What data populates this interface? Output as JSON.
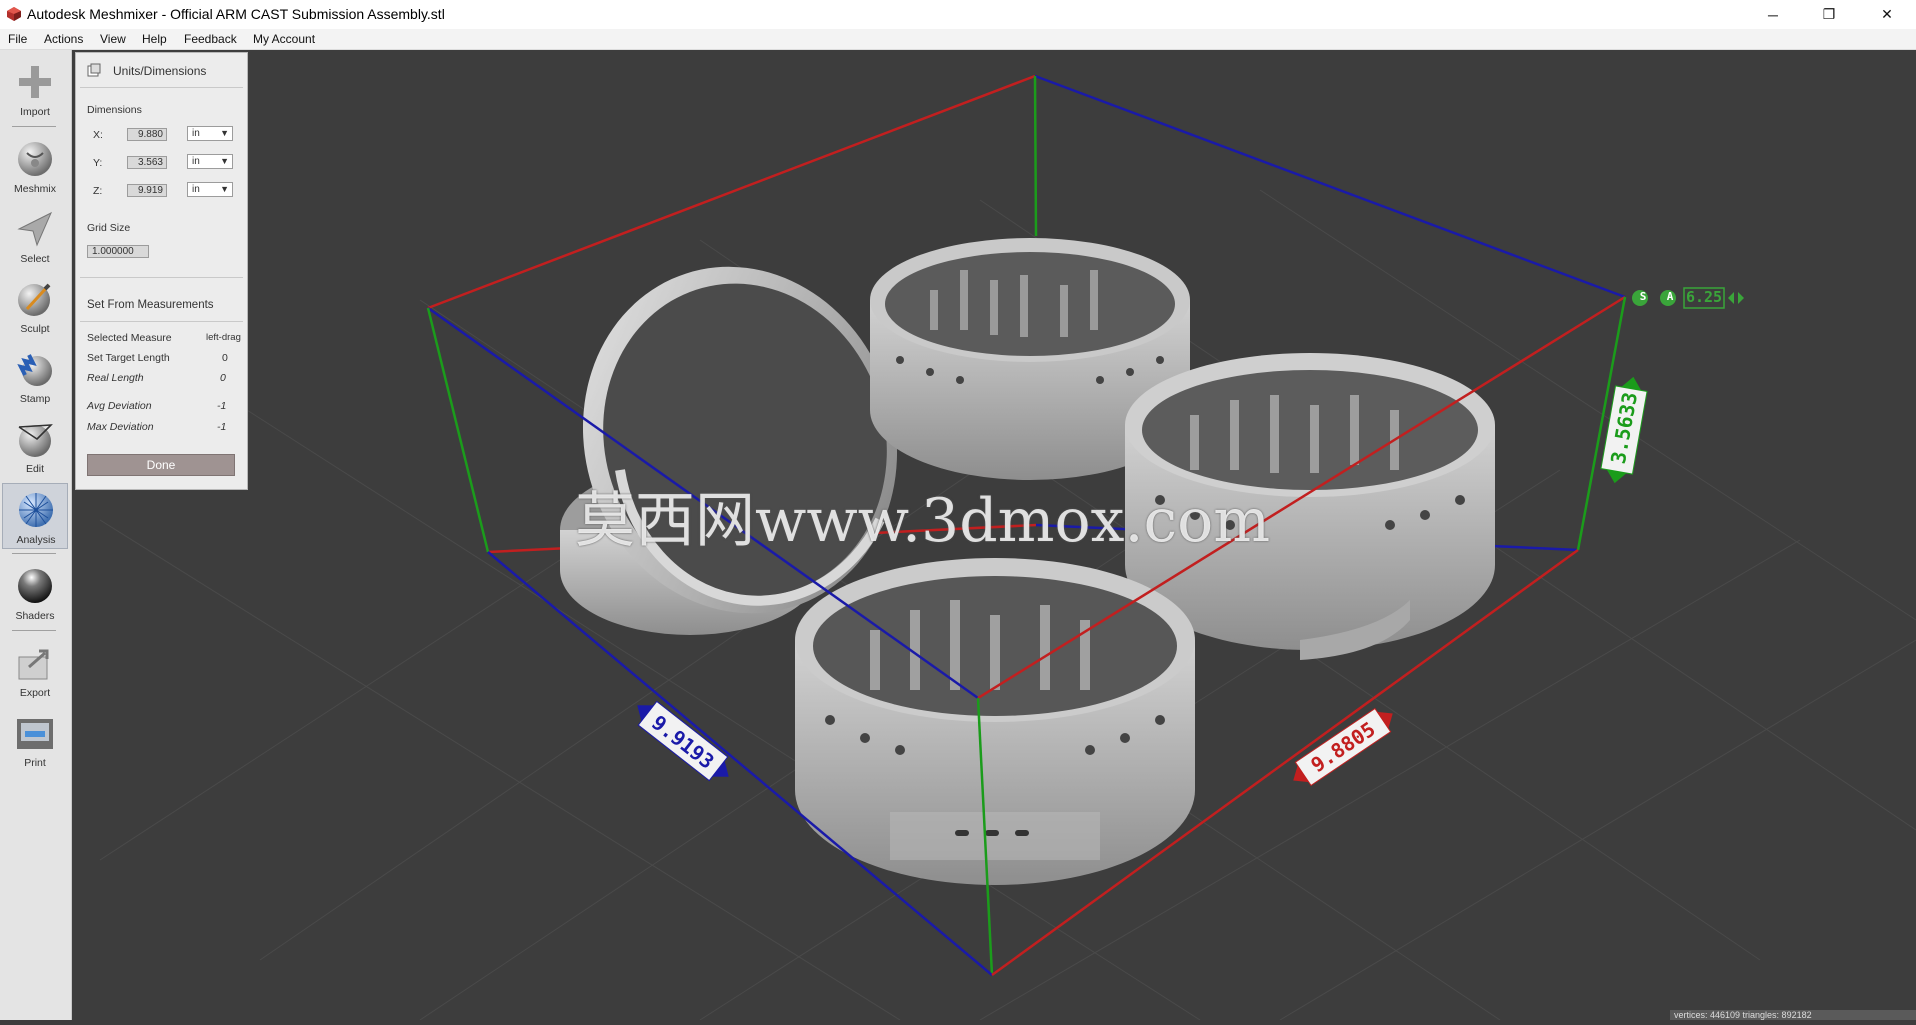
{
  "window": {
    "title": "Autodesk Meshmixer - Official ARM CAST Submission Assembly.stl",
    "minimize": "─",
    "restore": "❐",
    "close": "✕"
  },
  "menu": [
    "File",
    "Actions",
    "View",
    "Help",
    "Feedback",
    "My Account"
  ],
  "toolbar": {
    "items": [
      {
        "label": "Import",
        "icon": "plus-icon"
      },
      {
        "label": "Meshmix",
        "icon": "meshmix-icon"
      },
      {
        "label": "Select",
        "icon": "arrow-cursor-icon"
      },
      {
        "label": "Sculpt",
        "icon": "sculpt-brush-icon"
      },
      {
        "label": "Stamp",
        "icon": "stamp-icon"
      },
      {
        "label": "Edit",
        "icon": "edit-icon"
      },
      {
        "label": "Analysis",
        "icon": "analysis-icon"
      },
      {
        "label": "Shaders",
        "icon": "shader-sphere-icon"
      },
      {
        "label": "Export",
        "icon": "export-icon"
      },
      {
        "label": "Print",
        "icon": "printer-icon"
      }
    ],
    "active": "Analysis"
  },
  "panel": {
    "title": "Units/Dimensions",
    "dimensions_label": "Dimensions",
    "x_label": "X:",
    "x_value": "9.880",
    "x_unit": "in",
    "y_label": "Y:",
    "y_value": "3.563",
    "y_unit": "in",
    "z_label": "Z:",
    "z_value": "9.919",
    "z_unit": "in",
    "grid_label": "Grid Size",
    "grid_value": "1.000000",
    "measure_header": "Set From Measurements",
    "selected_measure_label": "Selected Measure",
    "selected_measure_value": "left-drag",
    "target_length_label": "Set Target Length",
    "target_length_value": "0",
    "real_length_label": "Real Length",
    "real_length_value": "0",
    "avg_dev_label": "Avg Deviation",
    "avg_dev_value": "-1",
    "max_dev_label": "Max Deviation",
    "max_dev_value": "-1",
    "done_label": "Done"
  },
  "viewport": {
    "snap_label": "S",
    "auto_label": "A",
    "grid_readout": "6.25",
    "measure_x": "9.8805",
    "measure_y": "3.5633",
    "measure_z": "9.9193",
    "watermark": "莫西网www.3dmox.com",
    "status": "vertices: 446109 triangles: 892182"
  },
  "colors": {
    "background": "#3d3d3d",
    "toolbar": "#e4e4e4",
    "x_axis": "#c21f1f",
    "y_axis": "#1b9c1b",
    "z_axis": "#1a1aa8",
    "mesh": "#bcbcbc"
  }
}
